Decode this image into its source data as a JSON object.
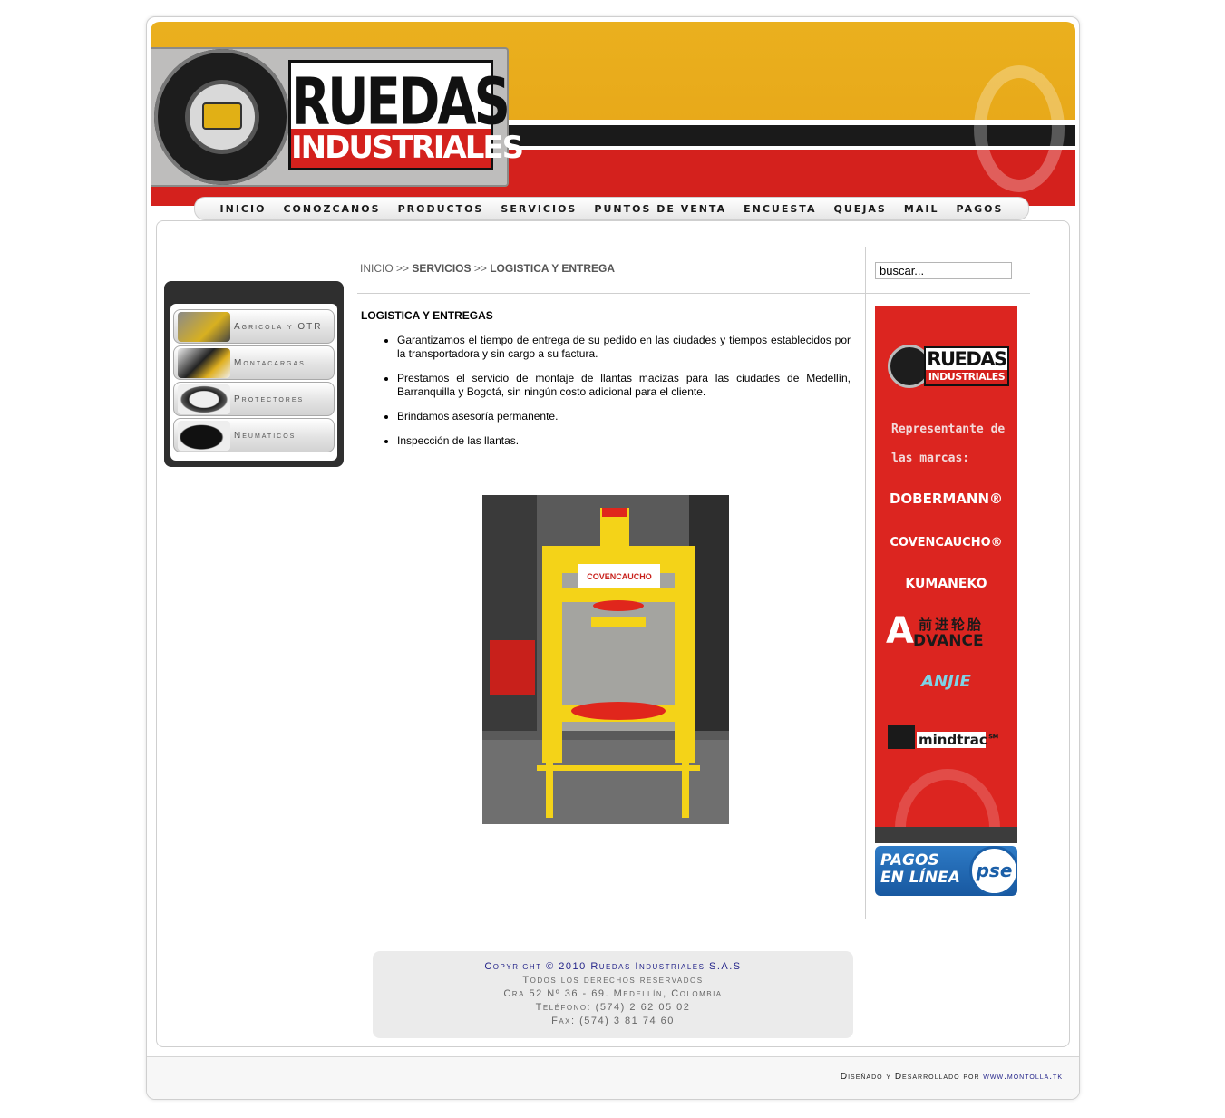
{
  "header": {
    "logo_word1": "RUEDAS",
    "logo_word2": "INDUSTRIALES",
    "colors": {
      "yellow": "#eab01e",
      "black_band": "#1a1a1a",
      "red": "#d4211d"
    }
  },
  "nav": {
    "items": [
      "INICIO",
      "CONOZCANOS",
      "PRODUCTOS",
      "SERVICIOS",
      "PUNTOS DE VENTA",
      "ENCUESTA",
      "QUEJAS",
      "MAIL",
      "PAGOS"
    ]
  },
  "sidebar": {
    "items": [
      {
        "label": "Agricola y OTR",
        "icon": "loader-icon"
      },
      {
        "label": "Montacargas",
        "icon": "forklift-icon"
      },
      {
        "label": "Protectores",
        "icon": "tire-protector-icon"
      },
      {
        "label": "Neumaticos",
        "icon": "inner-tube-icon"
      }
    ]
  },
  "breadcrumb": {
    "home": "INICIO",
    "sep": ">>",
    "section": "SERVICIOS",
    "page": "LOGISTICA Y ENTREGA"
  },
  "search": {
    "value": "buscar..."
  },
  "main": {
    "title": "LOGISTICA Y ENTREGAS",
    "bullets": [
      "Garantizamos el tiempo de entrega de su pedido en las ciudades y tiempos establecidos por la transportadora y sin cargo a su factura.",
      "Prestamos el servicio de montaje de llantas macizas para las ciudades de Medellín, Barranquilla y Bogotá, sin ningún costo adicional para el cliente.",
      "Brindamos asesoría permanente.",
      "Inspección de las llantas."
    ],
    "photo_sign": "COVENCAUCHO"
  },
  "brand_banner": {
    "logo_word1": "RUEDAS",
    "logo_word2": "INDUSTRIALES",
    "rep_line1": "Representante de",
    "rep_line2": "las marcas:",
    "brands": [
      "DOBERMANN®",
      "COVENCAUCHO®",
      "KUMANEKO",
      "前进轮胎",
      "DVANCE",
      "ANJIE",
      "mindtrac℠"
    ]
  },
  "pse": {
    "line1": "PAGOS",
    "line2": "EN LÍNEA",
    "badge": "pse"
  },
  "footer": {
    "copyright": "Copyright © 2010 Ruedas Industriales S.A.S",
    "rights": "Todos los derechos reservados",
    "address": "Cra 52 Nº 36 - 69. Medellín, Colombia",
    "phone": "Teléfono: (574) 2 62 05 02",
    "fax": "Fax: (574) 3 81 74 60",
    "designer_prefix": "Diseñado y Desarrollado por",
    "designer_link": "www.montolla.tk"
  }
}
